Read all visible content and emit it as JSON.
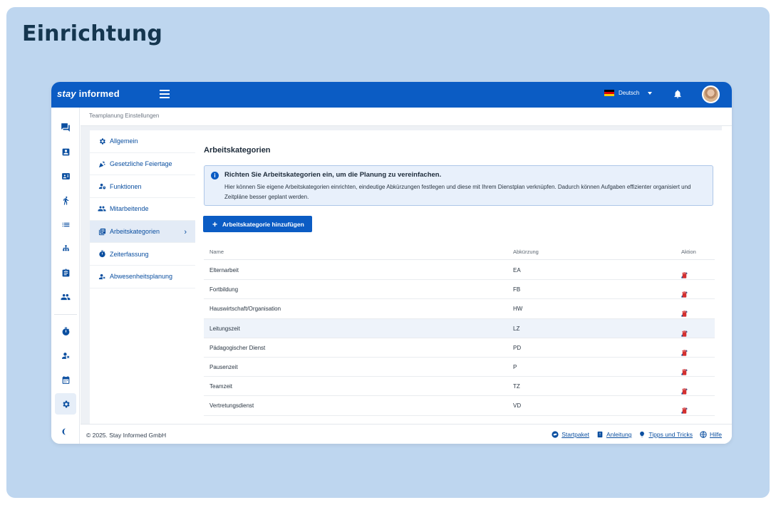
{
  "page_heading": "Einrichtung",
  "app": {
    "brand": {
      "stay": "stay",
      "informed": " informed"
    },
    "language": "Deutsch",
    "breadcrumb": "Teamplanung Einstellungen",
    "icon_sidebar": [
      "chat-icon",
      "contact-card-icon",
      "badge-icon",
      "person-walking-icon",
      "list-icon",
      "org-chart-icon",
      "clipboard-icon",
      "group-icon",
      "timer-icon",
      "person-off-icon",
      "calendar-icon",
      "settings-icon",
      "dark-mode-icon"
    ],
    "settings_nav": [
      {
        "label": "Allgemein",
        "icon": "gear-icon"
      },
      {
        "label": "Gesetzliche Feiertage",
        "icon": "party-popper-icon"
      },
      {
        "label": "Funktionen",
        "icon": "person-settings-icon"
      },
      {
        "label": "Mitarbeitende",
        "icon": "people-icon"
      },
      {
        "label": "Arbeitskategorien",
        "icon": "library-icon",
        "active": true
      },
      {
        "label": "Zeiterfassung",
        "icon": "timer-icon"
      },
      {
        "label": "Abwesenheitsplanung",
        "icon": "person-off-icon"
      }
    ],
    "main": {
      "title": "Arbeitskategorien",
      "info_title": "Richten Sie Arbeitskategorien ein, um die Planung zu vereinfachen.",
      "info_body": "Hier können Sie eigene Arbeitskategorien einrichten, eindeutige Abkürzungen festlegen und diese mit Ihrem Dienstplan verknüpfen. Dadurch können Aufgaben effizienter organisiert und Zeitpläne besser geplant werden.",
      "add_button": "Arbeitskategorie hinzufügen",
      "columns": {
        "name": "Name",
        "abbr": "Abkürzung",
        "action": "Aktion"
      },
      "rows": [
        {
          "name": "Elternarbeit",
          "abbr": "EA"
        },
        {
          "name": "Fortbildung",
          "abbr": "FB"
        },
        {
          "name": "Hauswirtschaft/Organisation",
          "abbr": "HW"
        },
        {
          "name": "Leitungszeit",
          "abbr": "LZ"
        },
        {
          "name": "Pädagogischer Dienst",
          "abbr": "PD"
        },
        {
          "name": "Pausenzeit",
          "abbr": "P"
        },
        {
          "name": "Teamzeit",
          "abbr": "TZ"
        },
        {
          "name": "Vertretungsdienst",
          "abbr": "VD"
        }
      ]
    },
    "footer": {
      "copyright": "© 2025. Stay Informed GmbH",
      "links": [
        "Startpaket",
        "Anleitung",
        "Tipps und Tricks",
        "Hilfe"
      ]
    },
    "colors": {
      "primary": "#0b5cc4",
      "delete": "#d32f2f",
      "background": "#bed6ef"
    }
  }
}
